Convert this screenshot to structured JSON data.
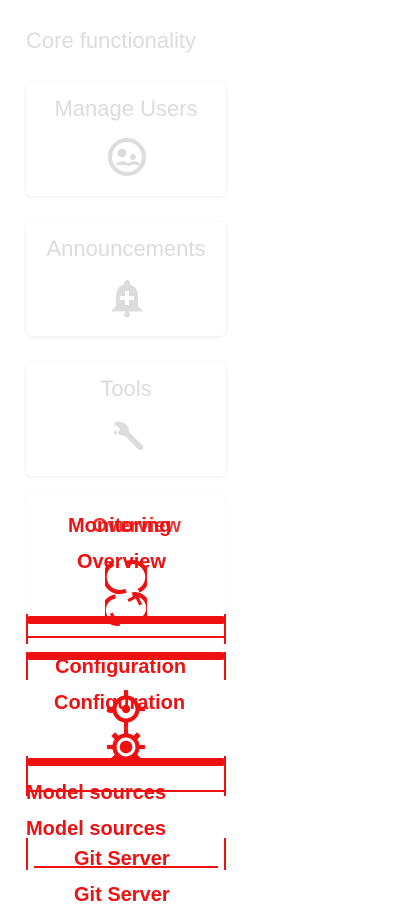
{
  "section": {
    "title": "Core functionality"
  },
  "cards": [
    {
      "label": "Manage Users",
      "icon": "face-icon"
    },
    {
      "label": "Announcements",
      "icon": "bell-plus-icon"
    },
    {
      "label": "Tools",
      "icon": "wrench-icon"
    }
  ],
  "overlay": {
    "monitoring": "Monitoring",
    "overview": "Overview",
    "configuration": "Configuration",
    "model_sources": "Model sources",
    "git_server": "Git Server",
    "git_server_sub": "Git Server",
    "sync_icon": "sync-icon",
    "gear_icon": "gear-icon"
  },
  "colors": {
    "faded_text": "#dcdcdc",
    "overlay_red": "#ee1111"
  }
}
